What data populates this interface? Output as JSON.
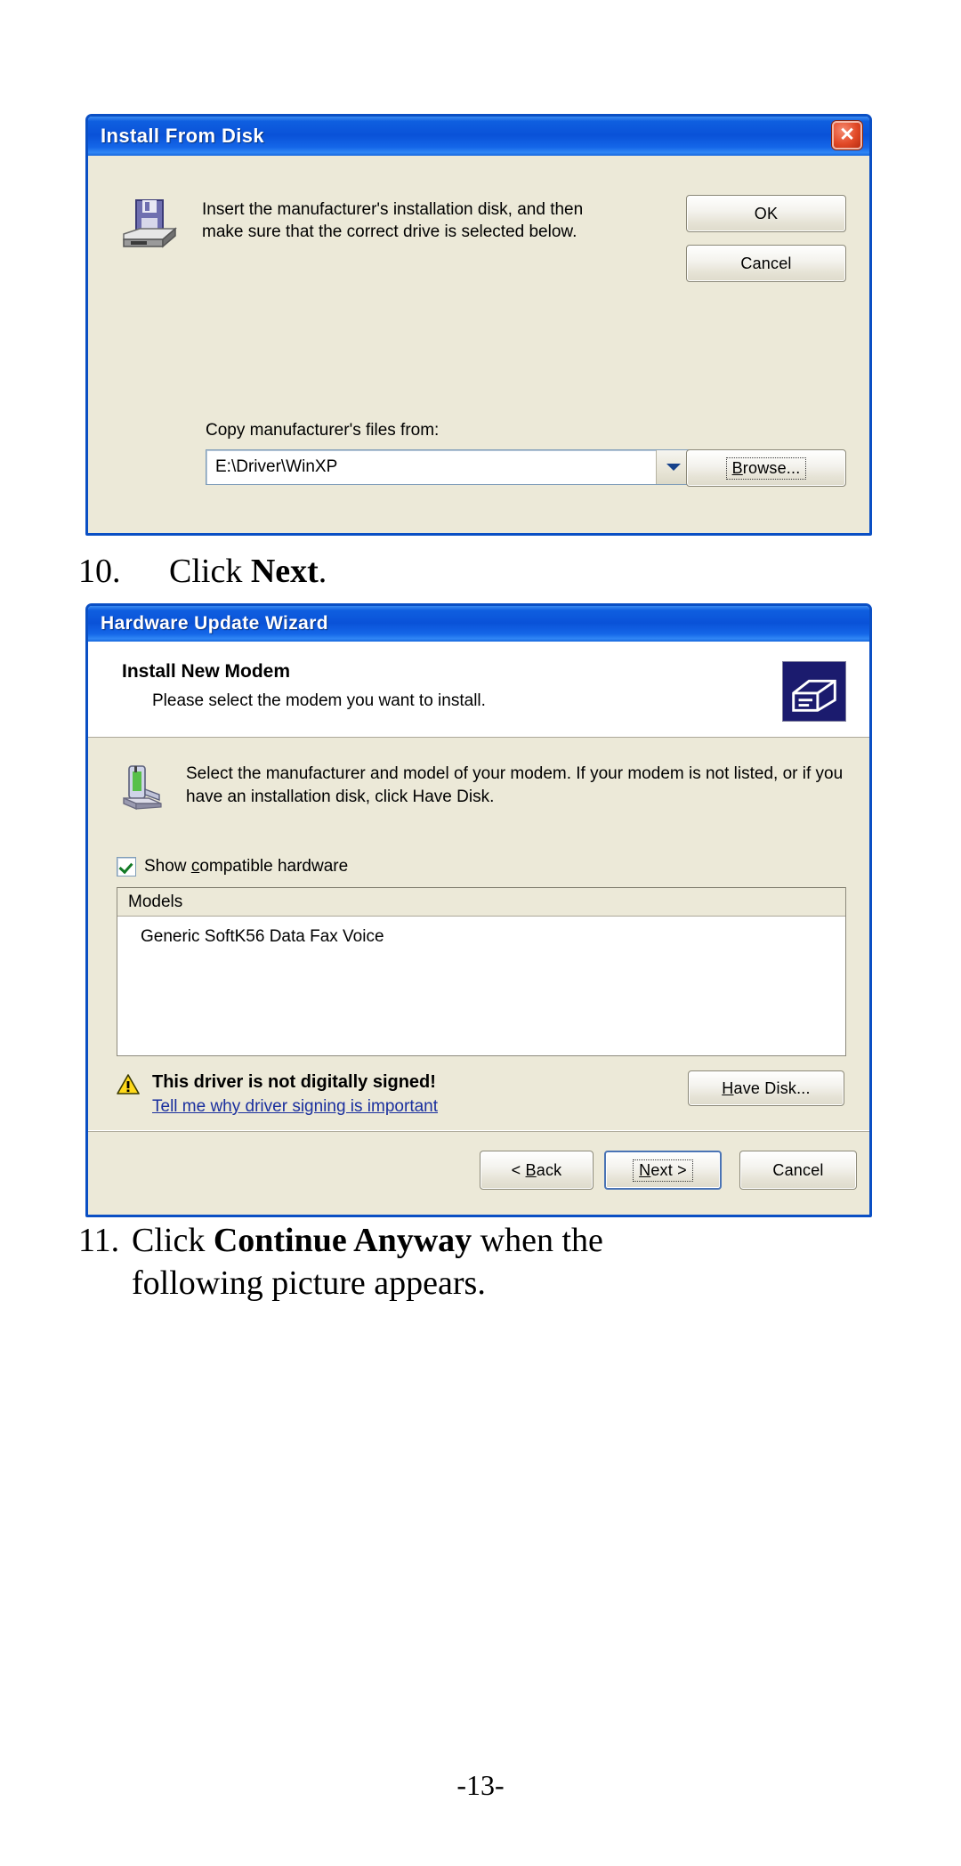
{
  "document": {
    "page_number": "-13-"
  },
  "install_from_disk": {
    "title": "Install From Disk",
    "close_glyph": "✕",
    "icon_name": "floppy-disk-icon",
    "message_line1": "Insert the manufacturer's installation disk, and then",
    "message_line2": "make sure that the correct drive is selected below.",
    "ok_label": "OK",
    "cancel_label": "Cancel",
    "copy_label": "Copy manufacturer's files from:",
    "path_value": "E:\\Driver\\WinXP",
    "browse_label": "Browse..."
  },
  "step10": {
    "number": "10.",
    "text_before": "Click ",
    "bold": "Next",
    "text_after": "."
  },
  "hardware_update_wizard": {
    "title": "Hardware Update Wizard",
    "heading": "Install New Modem",
    "subheading": "Please select the modem you want to install.",
    "banner_icon_name": "hardware-box-icon",
    "modem_icon_name": "modem-icon",
    "description_line1": "Select the manufacturer and model of your modem. If your modem is not listed, or if you",
    "description_line2": "have an installation disk, click Have Disk.",
    "show_compatible_label": "Show compatible hardware",
    "show_compatible_checked": true,
    "models_column_header": "Models",
    "models": [
      "Generic SoftK56 Data Fax Voice"
    ],
    "warning_title": "This driver is not digitally signed!",
    "warning_link": "Tell me why driver signing is important",
    "have_disk_label": "Have Disk...",
    "back_label": "< Back",
    "next_label": "Next >",
    "cancel_label": "Cancel"
  },
  "step11": {
    "number": "11.",
    "text_before": "Click ",
    "bold": "Continue Anyway",
    "text_after": " when the",
    "line2": "following picture appears."
  },
  "colors": {
    "titlebar_blue": "#0a52d8",
    "window_border": "#0a4fc4",
    "dialog_face": "#ece9d8",
    "link_blue": "#1a2f9e",
    "close_red": "#e24a28"
  }
}
